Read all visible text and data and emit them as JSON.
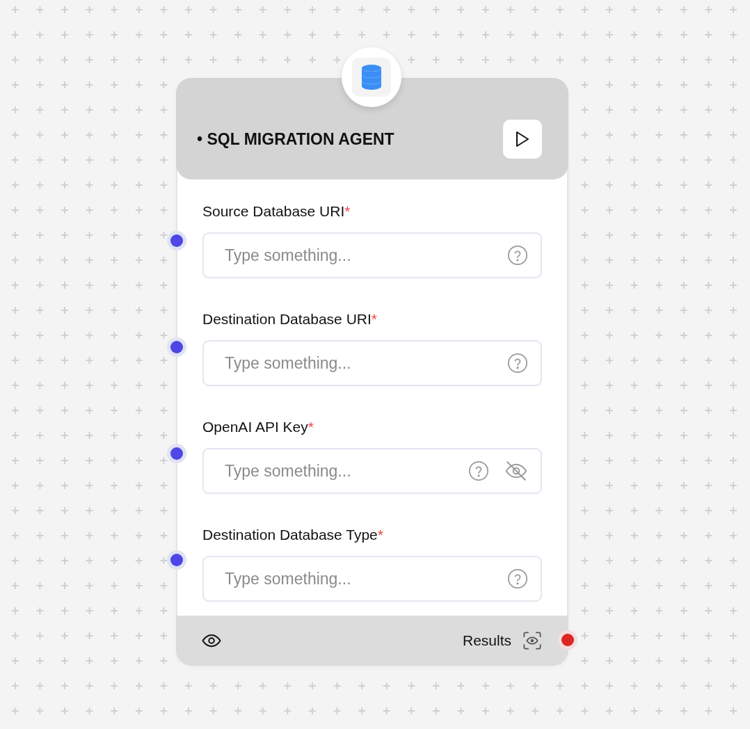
{
  "node": {
    "title": "• SQL MIGRATION AGENT",
    "fields": [
      {
        "label": "Source Database URI",
        "required_mark": "*",
        "placeholder": "Type something...",
        "kind": "text"
      },
      {
        "label": "Destination Database URI",
        "required_mark": "*",
        "placeholder": "Type something...",
        "kind": "text"
      },
      {
        "label": "OpenAI API Key",
        "required_mark": "*",
        "placeholder": "Type something...",
        "kind": "secret"
      },
      {
        "label": "Destination Database Type",
        "required_mark": "*",
        "placeholder": "Type something...",
        "kind": "text"
      }
    ],
    "footer": {
      "output_label": "Results"
    }
  }
}
